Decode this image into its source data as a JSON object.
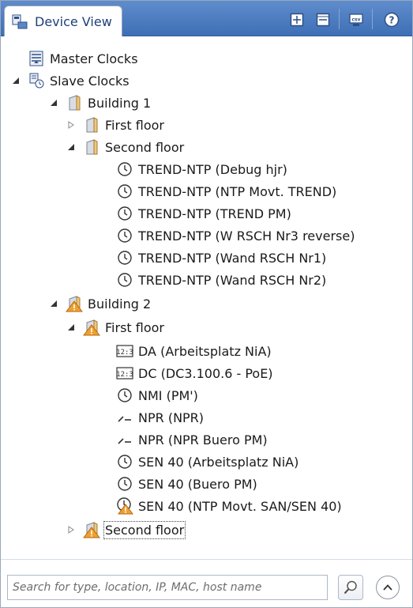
{
  "header": {
    "tab_label": "Device View",
    "tools": [
      "expand-all-icon",
      "collapse-all-icon",
      "csv-export-icon",
      "help-icon"
    ]
  },
  "tree": {
    "master_clocks": {
      "label": "Master Clocks",
      "icon": "master-clock-icon"
    },
    "slave_clocks": {
      "label": "Slave Clocks",
      "icon": "slave-clock-icon",
      "expanded": true
    },
    "building1": {
      "label": "Building 1",
      "expanded": true,
      "first_floor": {
        "label": "First floor",
        "expanded": false
      },
      "second_floor": {
        "label": "Second floor",
        "expanded": true,
        "devices": [
          {
            "label": "TREND-NTP (Debug hjr)",
            "icon": "clock-icon"
          },
          {
            "label": "TREND-NTP (NTP Movt. TREND)",
            "icon": "clock-icon"
          },
          {
            "label": "TREND-NTP (TREND PM)",
            "icon": "clock-icon"
          },
          {
            "label": "TREND-NTP (W RSCH Nr3 reverse)",
            "icon": "clock-icon"
          },
          {
            "label": "TREND-NTP (Wand RSCH Nr1)",
            "icon": "clock-icon"
          },
          {
            "label": "TREND-NTP (Wand RSCH Nr2)",
            "icon": "clock-icon"
          }
        ]
      }
    },
    "building2": {
      "label": "Building 2",
      "warning": true,
      "expanded": true,
      "first_floor": {
        "label": "First floor",
        "warning": true,
        "expanded": true,
        "devices": [
          {
            "label": "DA (Arbeitsplatz NiA)",
            "icon": "digital-clock-icon"
          },
          {
            "label": "DC (DC3.100.6 - PoE)",
            "icon": "digital-clock-icon"
          },
          {
            "label": "NMI (PM')",
            "icon": "clock-icon"
          },
          {
            "label": "NPR (NPR)",
            "icon": "pulse-icon"
          },
          {
            "label": "NPR (NPR Buero PM)",
            "icon": "pulse-icon"
          },
          {
            "label": "SEN 40 (Arbeitsplatz NiA)",
            "icon": "clock-icon"
          },
          {
            "label": "SEN 40 (Buero PM)",
            "icon": "clock-icon"
          },
          {
            "label": "SEN 40 (NTP Movt. SAN/SEN 40)",
            "icon": "clock-warning-icon"
          }
        ]
      },
      "second_floor": {
        "label": "Second floor",
        "warning": true,
        "expanded": false
      }
    }
  },
  "search": {
    "placeholder": "Search for type, location, IP, MAC, host name",
    "value": ""
  },
  "colors": {
    "header": "#4a7bc0",
    "warning": "#f0a030",
    "text": "#1a1a1a"
  }
}
